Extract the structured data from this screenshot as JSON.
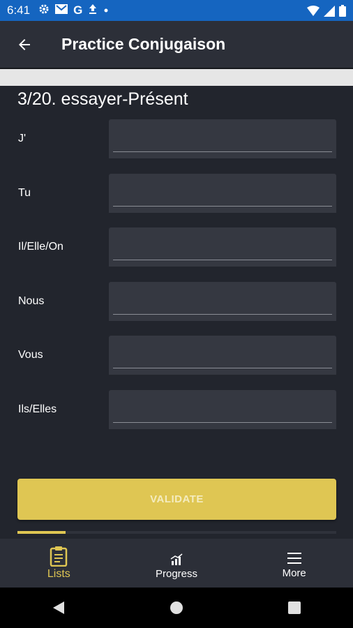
{
  "status_bar": {
    "time": "6:41",
    "icons": [
      "gear-icon",
      "gmail-icon",
      "google-icon",
      "upload-icon",
      "dot-icon",
      "wifi-icon",
      "signal-icon",
      "battery-icon"
    ],
    "color": "#1565c0"
  },
  "app_bar": {
    "title": "Practice Conjugaison",
    "back_icon": "arrow-back-icon"
  },
  "question": {
    "text": "3/20. essayer-Présent"
  },
  "conjugation_rows": [
    {
      "pronoun": "J'",
      "value": ""
    },
    {
      "pronoun": "Tu",
      "value": ""
    },
    {
      "pronoun": "Il/Elle/On",
      "value": ""
    },
    {
      "pronoun": "Nous",
      "value": ""
    },
    {
      "pronoun": "Vous",
      "value": ""
    },
    {
      "pronoun": "Ils/Elles",
      "value": ""
    }
  ],
  "validate_button": {
    "label": "VALIDATE"
  },
  "progress": {
    "current": 3,
    "total": 20,
    "fraction": 0.15
  },
  "bottom_nav": {
    "items": [
      {
        "label": "Lists",
        "icon": "clipboard-icon",
        "active": true
      },
      {
        "label": "Progress",
        "icon": "chart-icon",
        "active": false
      },
      {
        "label": "More",
        "icon": "menu-icon",
        "active": false
      }
    ]
  },
  "colors": {
    "accent": "#dfc653",
    "background": "#22252d",
    "surface": "#2c2f38",
    "field": "#353841"
  }
}
